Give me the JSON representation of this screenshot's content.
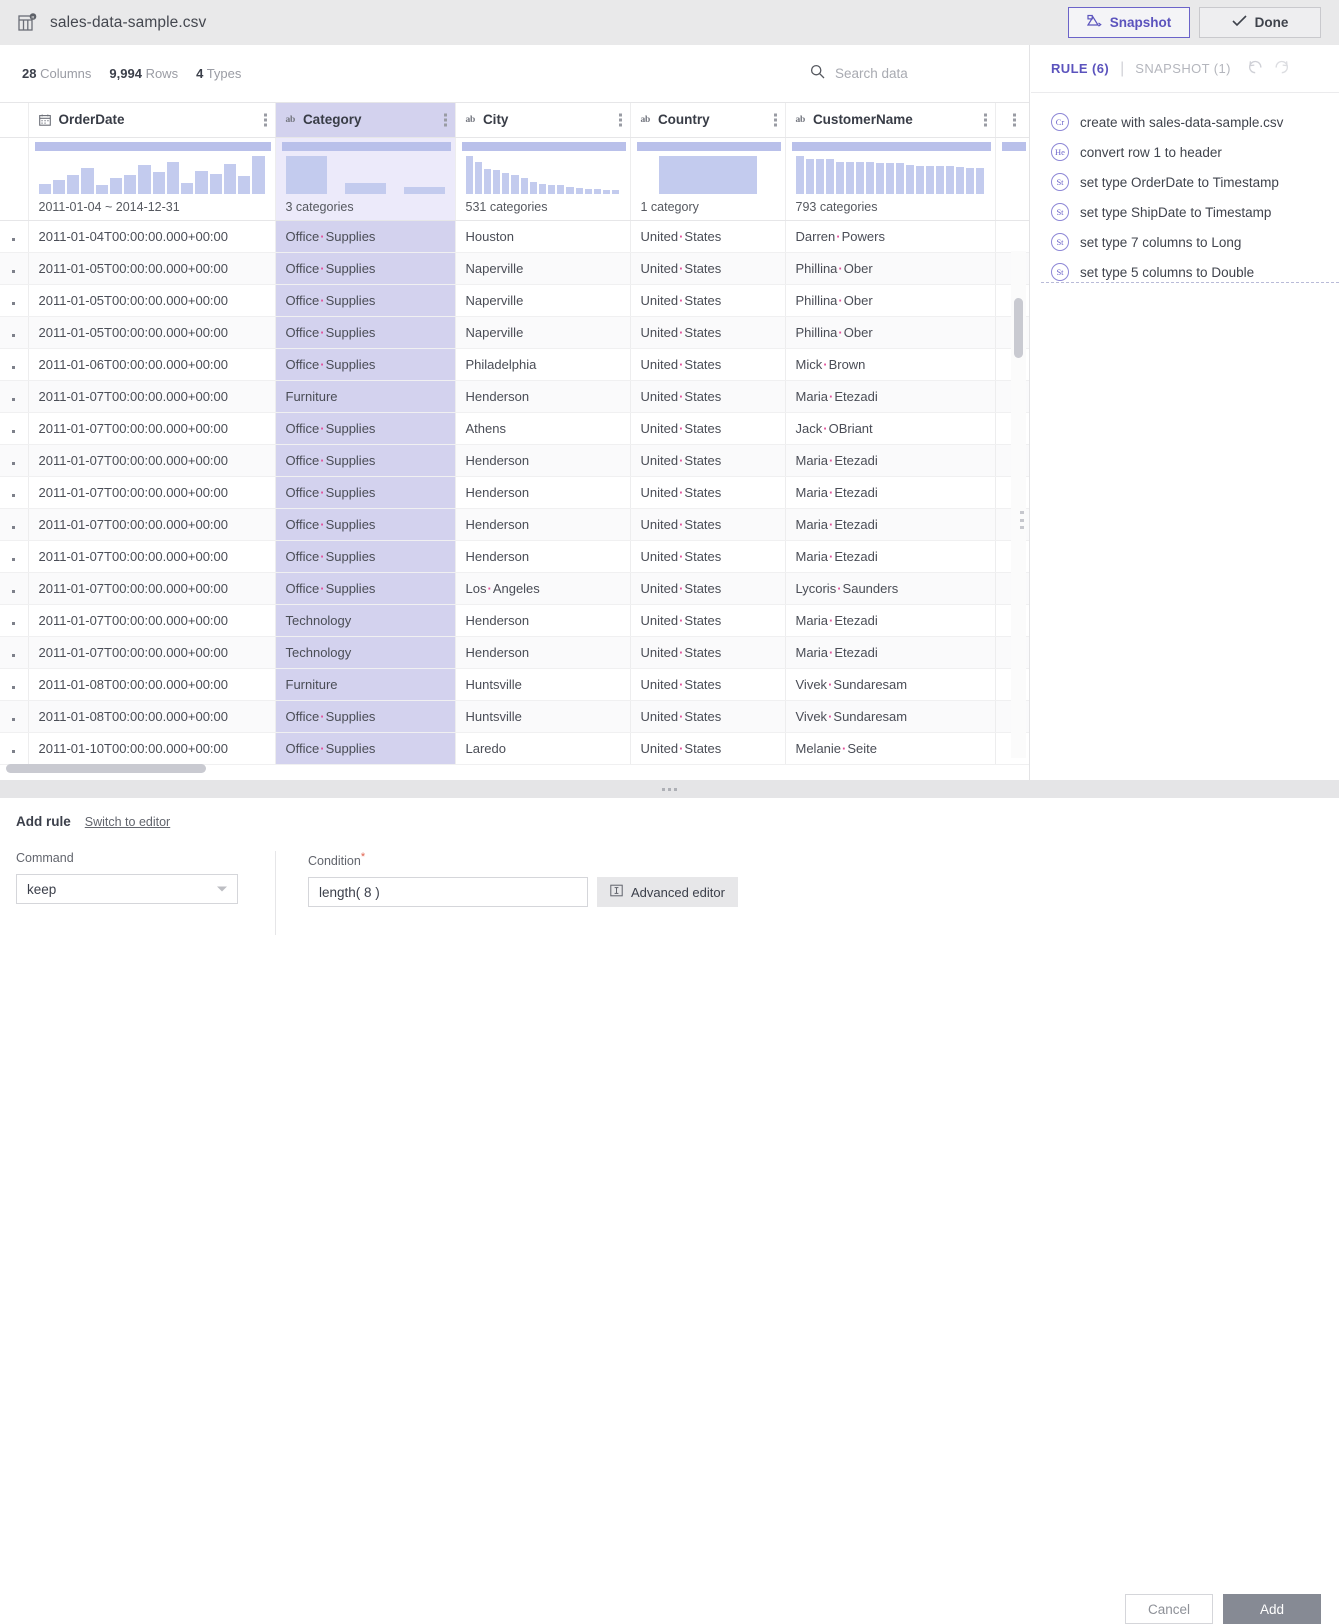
{
  "titlebar": {
    "file_name": "sales-data-sample.csv",
    "file_icon": "table-file-icon",
    "snapshot_label": "Snapshot",
    "done_label": "Done",
    "accent": "#5b53bd"
  },
  "meta": {
    "columns_count": "28",
    "columns_label": "Columns",
    "rows_count": "9,994",
    "rows_label": "Rows",
    "types_count": "4",
    "types_label": "Types"
  },
  "search": {
    "placeholder": "Search data"
  },
  "grid": {
    "columns": [
      {
        "name": "OrderDate",
        "type_icon": "calendar",
        "summary": "2011-01-04 ~ 2014-12-31",
        "selected": false
      },
      {
        "name": "Category",
        "type_icon": "ab",
        "summary": "3 categories",
        "selected": true
      },
      {
        "name": "City",
        "type_icon": "ab",
        "summary": "531 categories",
        "selected": false
      },
      {
        "name": "Country",
        "type_icon": "ab",
        "summary": "1 category",
        "selected": false
      },
      {
        "name": "CustomerName",
        "type_icon": "ab",
        "summary": "793 categories",
        "selected": false
      }
    ],
    "rows": [
      {
        "OrderDate": "2011-01-04T00:00:00.000+00:00",
        "Category": "Office·Supplies",
        "City": "Houston",
        "Country": "United·States",
        "CustomerName": "Darren·Powers"
      },
      {
        "OrderDate": "2011-01-05T00:00:00.000+00:00",
        "Category": "Office·Supplies",
        "City": "Naperville",
        "Country": "United·States",
        "CustomerName": "Phillina·Ober"
      },
      {
        "OrderDate": "2011-01-05T00:00:00.000+00:00",
        "Category": "Office·Supplies",
        "City": "Naperville",
        "Country": "United·States",
        "CustomerName": "Phillina·Ober"
      },
      {
        "OrderDate": "2011-01-05T00:00:00.000+00:00",
        "Category": "Office·Supplies",
        "City": "Naperville",
        "Country": "United·States",
        "CustomerName": "Phillina·Ober"
      },
      {
        "OrderDate": "2011-01-06T00:00:00.000+00:00",
        "Category": "Office·Supplies",
        "City": "Philadelphia",
        "Country": "United·States",
        "CustomerName": "Mick·Brown"
      },
      {
        "OrderDate": "2011-01-07T00:00:00.000+00:00",
        "Category": "Furniture",
        "City": "Henderson",
        "Country": "United·States",
        "CustomerName": "Maria·Etezadi"
      },
      {
        "OrderDate": "2011-01-07T00:00:00.000+00:00",
        "Category": "Office·Supplies",
        "City": "Athens",
        "Country": "United·States",
        "CustomerName": "Jack·OBriant"
      },
      {
        "OrderDate": "2011-01-07T00:00:00.000+00:00",
        "Category": "Office·Supplies",
        "City": "Henderson",
        "Country": "United·States",
        "CustomerName": "Maria·Etezadi"
      },
      {
        "OrderDate": "2011-01-07T00:00:00.000+00:00",
        "Category": "Office·Supplies",
        "City": "Henderson",
        "Country": "United·States",
        "CustomerName": "Maria·Etezadi"
      },
      {
        "OrderDate": "2011-01-07T00:00:00.000+00:00",
        "Category": "Office·Supplies",
        "City": "Henderson",
        "Country": "United·States",
        "CustomerName": "Maria·Etezadi"
      },
      {
        "OrderDate": "2011-01-07T00:00:00.000+00:00",
        "Category": "Office·Supplies",
        "City": "Henderson",
        "Country": "United·States",
        "CustomerName": "Maria·Etezadi"
      },
      {
        "OrderDate": "2011-01-07T00:00:00.000+00:00",
        "Category": "Office·Supplies",
        "City": "Los·Angeles",
        "Country": "United·States",
        "CustomerName": "Lycoris·Saunders"
      },
      {
        "OrderDate": "2011-01-07T00:00:00.000+00:00",
        "Category": "Technology",
        "City": "Henderson",
        "Country": "United·States",
        "CustomerName": "Maria·Etezadi"
      },
      {
        "OrderDate": "2011-01-07T00:00:00.000+00:00",
        "Category": "Technology",
        "City": "Henderson",
        "Country": "United·States",
        "CustomerName": "Maria·Etezadi"
      },
      {
        "OrderDate": "2011-01-08T00:00:00.000+00:00",
        "Category": "Furniture",
        "City": "Huntsville",
        "Country": "United·States",
        "CustomerName": "Vivek·Sundaresam"
      },
      {
        "OrderDate": "2011-01-08T00:00:00.000+00:00",
        "Category": "Office·Supplies",
        "City": "Huntsville",
        "Country": "United·States",
        "CustomerName": "Vivek·Sundaresam"
      },
      {
        "OrderDate": "2011-01-10T00:00:00.000+00:00",
        "Category": "Office·Supplies",
        "City": "Laredo",
        "Country": "United·States",
        "CustomerName": "Melanie·Seite"
      }
    ]
  },
  "chart_data": {
    "type": "bar",
    "title": "Column distribution sparkline histograms",
    "charts": [
      {
        "column": "OrderDate",
        "values": [
          22,
          30,
          42,
          56,
          18,
          34,
          40,
          62,
          48,
          70,
          24,
          50,
          44,
          66,
          38,
          84
        ],
        "range_label": "2011-01-04 ~ 2014-12-31"
      },
      {
        "column": "Category",
        "values": [
          100,
          28,
          18
        ],
        "categories": [
          "Office Supplies",
          "Furniture",
          "Technology"
        ],
        "range_label": "3 categories"
      },
      {
        "column": "City",
        "values": [
          96,
          80,
          62,
          60,
          52,
          48,
          40,
          30,
          24,
          22,
          22,
          16,
          14,
          12,
          12,
          10,
          9
        ],
        "range_label": "531 categories"
      },
      {
        "column": "Country",
        "values": [
          100
        ],
        "categories": [
          "United States"
        ],
        "range_label": "1 category"
      },
      {
        "column": "CustomerName",
        "values": [
          96,
          88,
          88,
          88,
          80,
          80,
          80,
          80,
          76,
          76,
          76,
          72,
          70,
          70,
          70,
          70,
          68,
          64,
          64
        ],
        "range_label": "793 categories"
      }
    ]
  },
  "rule_panel": {
    "tab_rule": "RULE (6)",
    "tab_snapshot": "SNAPSHOT (1)",
    "undo_icon": "undo-icon",
    "redo_icon": "redo-icon",
    "rules": [
      {
        "badge": "Cr",
        "text": "create with sales-data-sample.csv"
      },
      {
        "badge": "He",
        "text": "convert row 1 to header"
      },
      {
        "badge": "St",
        "text": "set type OrderDate to Timestamp"
      },
      {
        "badge": "St",
        "text": "set type ShipDate to Timestamp"
      },
      {
        "badge": "St",
        "text": "set type 7 columns to Long"
      },
      {
        "badge": "St",
        "text": "set type 5 columns to Double"
      }
    ]
  },
  "add_rule": {
    "title": "Add rule",
    "switch_link": "Switch to editor",
    "command_label": "Command",
    "command_value": "keep",
    "condition_label": "Condition",
    "condition_required": "*",
    "condition_value": "length( 8 )",
    "advanced_editor_label": "Advanced editor",
    "cancel_label": "Cancel",
    "add_label": "Add"
  }
}
